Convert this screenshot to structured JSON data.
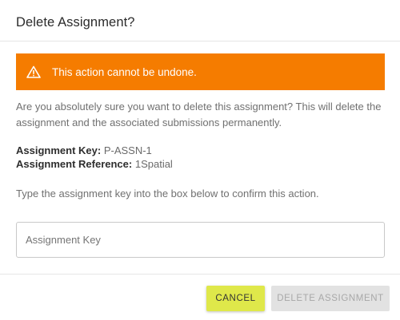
{
  "dialog": {
    "title": "Delete Assignment?",
    "alert": {
      "icon": "warning-icon",
      "text": "This action cannot be undone.",
      "color": "#f57c00"
    },
    "message": "Are you absolutely sure you want to delete this assignment? This will delete the assignment and the associated submissions permanently.",
    "key_label": "Assignment Key:",
    "key_value": "P-ASSN-1",
    "reference_label": "Assignment Reference:",
    "reference_value": "1Spatial",
    "instruction": "Type the assignment key into the box below to confirm this action.",
    "input": {
      "placeholder": "Assignment Key",
      "value": ""
    },
    "buttons": {
      "cancel": "CANCEL",
      "delete": "DELETE ASSIGNMENT"
    },
    "colors": {
      "cancel_bg": "#dfe84a",
      "delete_disabled_bg": "#e2e2e2"
    }
  }
}
